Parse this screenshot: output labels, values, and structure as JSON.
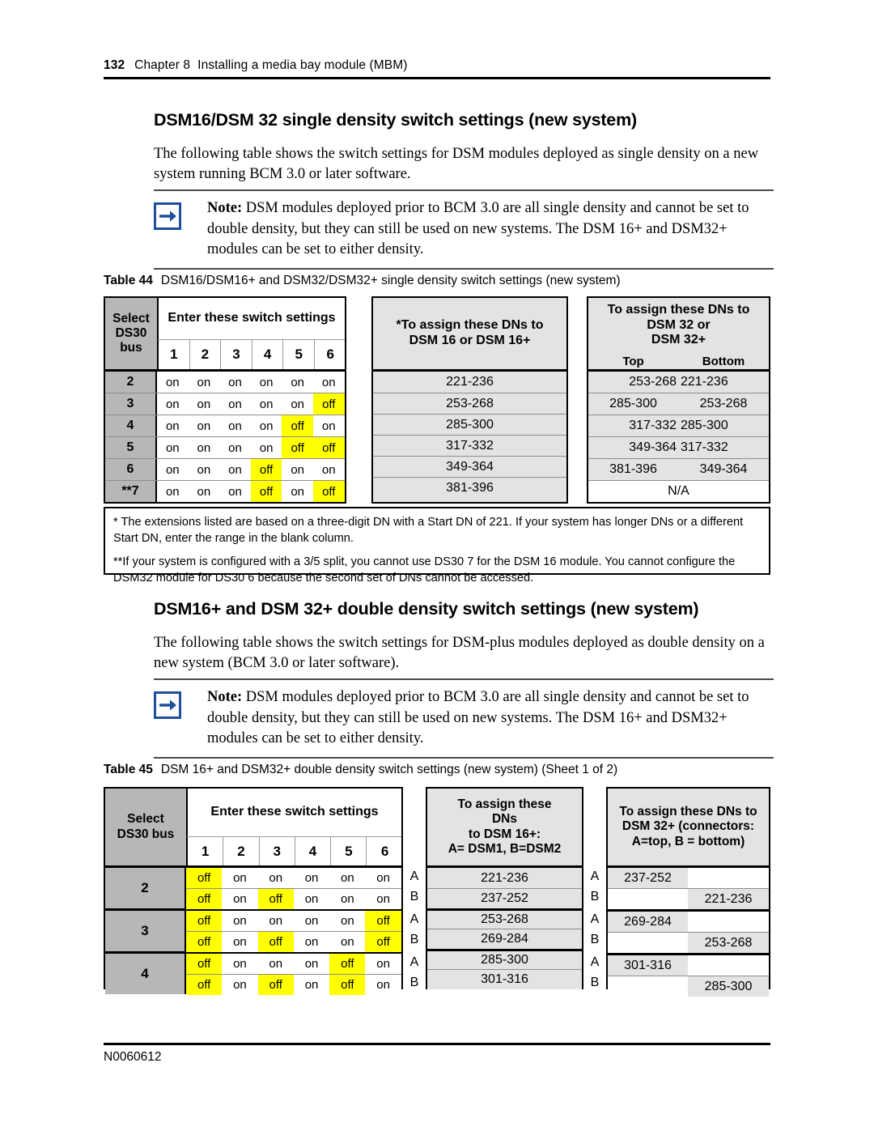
{
  "header": {
    "page_number": "132",
    "chapter": "Chapter 8",
    "chapter_title": "Installing a media bay module (MBM)"
  },
  "footer": {
    "doc_number": "N0060612"
  },
  "section1": {
    "heading": "DSM16/DSM 32 single density switch settings (new system)",
    "intro": "The following table shows the switch settings for DSM modules deployed as single density on a new system running BCM 3.0 or later software.",
    "note_label": "Note:",
    "note_text": " DSM modules deployed prior to BCM 3.0 are all single density and cannot be set to double density, but they can still be used on new systems. The DSM 16+ and DSM32+ modules can be set to either density.",
    "note_icon": "right-arrow-icon"
  },
  "table44": {
    "caption_label": "Table 44",
    "caption_text": "DSM16/DSM16+ and DSM32/DSM32+ single density switch settings (new system)",
    "col_select": "Select DS30 bus",
    "col_select_l1": "Select",
    "col_select_l2": "DS30",
    "col_select_l3": "bus",
    "col_switch": "Enter these switch settings",
    "switch_numbers": [
      "1",
      "2",
      "3",
      "4",
      "5",
      "6"
    ],
    "col_dsm16_l1": "*To assign these DNs to",
    "col_dsm16_l2": "DSM 16 or DSM 16+",
    "col_dsm32_l1": "To assign these DNs to",
    "col_dsm32_l2": "DSM 32 or",
    "col_dsm32_l3": "DSM 32+",
    "col_top": "Top",
    "col_bottom": "Bottom",
    "rows": [
      {
        "bus": "2",
        "switches": [
          "on",
          "on",
          "on",
          "on",
          "on",
          "on"
        ],
        "dsm16": "221-236",
        "top": "253-268",
        "bottom": "221-236",
        "tight": true
      },
      {
        "bus": "3",
        "switches": [
          "on",
          "on",
          "on",
          "on",
          "on",
          "off"
        ],
        "dsm16": "253-268",
        "top": "285-300",
        "bottom": "253-268",
        "tight": false
      },
      {
        "bus": "4",
        "switches": [
          "on",
          "on",
          "on",
          "on",
          "off",
          "on"
        ],
        "dsm16": "285-300",
        "top": "317-332",
        "bottom": "285-300",
        "tight": true
      },
      {
        "bus": "5",
        "switches": [
          "on",
          "on",
          "on",
          "on",
          "off",
          "off"
        ],
        "dsm16": "317-332",
        "top": "349-364",
        "bottom": "317-332",
        "tight": true
      },
      {
        "bus": "6",
        "switches": [
          "on",
          "on",
          "on",
          "off",
          "on",
          "on"
        ],
        "dsm16": "349-364",
        "top": "381-396",
        "bottom": "349-364",
        "tight": false
      },
      {
        "bus": "**7",
        "switches": [
          "on",
          "on",
          "on",
          "off",
          "on",
          "off"
        ],
        "dsm16": "381-396",
        "na": "N/A",
        "tight": true
      }
    ],
    "footnote1": "* The extensions listed are based on a three-digit DN with a Start DN of 221. If your system has longer DNs or a different Start DN, enter the range in the blank column.",
    "footnote2": "**If your system is configured with a 3/5 split, you cannot use DS30 7 for the DSM 16 module. You cannot configure the DSM32 module for DS30 6 because the second set of DNs cannot be accessed."
  },
  "section2": {
    "heading": "DSM16+ and DSM 32+ double density switch settings (new system)",
    "intro": "The following table shows the switch settings for DSM-plus modules deployed as double density on a new system (BCM 3.0 or later software).",
    "note_label": "Note:",
    "note_text": " DSM modules deployed prior to BCM 3.0 are all single density and cannot be set to double density, but they can still be used on new systems. The DSM 16+ and DSM32+ modules can be set to either density.",
    "note_icon": "right-arrow-icon"
  },
  "table45": {
    "caption_label": "Table 45",
    "caption_text": "DSM 16+ and DSM32+ double density switch settings (new system) (Sheet 1 of 2)",
    "col_select_l1": "Select",
    "col_select_l2": "DS30 bus",
    "col_switch": "Enter these switch settings",
    "switch_numbers": [
      "1",
      "2",
      "3",
      "4",
      "5",
      "6"
    ],
    "col_dsm16_l1": "To assign these",
    "col_dsm16_l2": "DNs",
    "col_dsm16_l3": "to DSM 16+:",
    "col_dsm16_l4": "A= DSM1, B=DSM2",
    "col_dsm32_l1": "To assign these DNs to",
    "col_dsm32_l2": "DSM 32+ (connectors:",
    "col_dsm32_l3": "A=top, B = bottom)",
    "groups": [
      {
        "bus": "2",
        "lines": [
          {
            "ab": "A",
            "switches": [
              "off",
              "on",
              "on",
              "on",
              "on",
              "on"
            ],
            "dsm16": "221-236",
            "ab2": "A",
            "left": "237-252",
            "right": ""
          },
          {
            "ab": "B",
            "switches": [
              "off",
              "on",
              "off",
              "on",
              "on",
              "on"
            ],
            "dsm16": "237-252",
            "ab2": "B",
            "left": "",
            "right": "221-236"
          }
        ]
      },
      {
        "bus": "3",
        "lines": [
          {
            "ab": "A",
            "switches": [
              "off",
              "on",
              "on",
              "on",
              "on",
              "off"
            ],
            "dsm16": "253-268",
            "ab2": "A",
            "left": "269-284",
            "right": ""
          },
          {
            "ab": "B",
            "switches": [
              "off",
              "on",
              "off",
              "on",
              "on",
              "off"
            ],
            "dsm16": "269-284",
            "ab2": "B",
            "left": "",
            "right": "253-268"
          }
        ]
      },
      {
        "bus": "4",
        "lines": [
          {
            "ab": "A",
            "switches": [
              "off",
              "on",
              "on",
              "on",
              "off",
              "on"
            ],
            "dsm16": "285-300",
            "ab2": "A",
            "left": "301-316",
            "right": ""
          },
          {
            "ab": "B",
            "switches": [
              "off",
              "on",
              "off",
              "on",
              "off",
              "on"
            ],
            "dsm16": "301-316",
            "ab2": "B",
            "left": "",
            "right": "285-300"
          }
        ]
      }
    ]
  }
}
